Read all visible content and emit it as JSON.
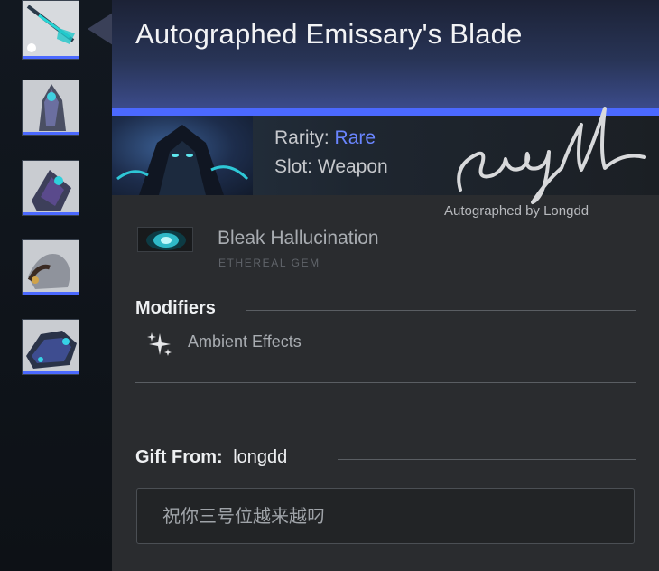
{
  "item": {
    "title": "Autographed Emissary's Blade",
    "rarity_label": "Rarity:",
    "rarity_value": "Rare",
    "slot_label": "Slot:",
    "slot_value": "Weapon",
    "autograph": "Autographed by Longdd",
    "signature_text": "Longdd"
  },
  "gem": {
    "name": "Bleak Hallucination",
    "type": "ETHEREAL GEM",
    "icon": "ethereal-gem-icon"
  },
  "modifiers": {
    "title": "Modifiers",
    "items": [
      {
        "label": "Ambient Effects",
        "icon": "sparkle-icon"
      }
    ]
  },
  "gift": {
    "label": "Gift From:",
    "from": "longdd",
    "message": "祝你三号位越来越叼"
  },
  "sidebar": {
    "items": [
      {
        "name": "emissary-blade",
        "selected": true
      },
      {
        "name": "hero-pose-1"
      },
      {
        "name": "hero-pose-2"
      },
      {
        "name": "hero-pose-3"
      },
      {
        "name": "hero-mount"
      }
    ]
  },
  "colors": {
    "rarity_rare": "#4b69ff",
    "panel_bg": "#2a2c2f",
    "header_top": "#1c2236",
    "header_bottom": "#3b4b8a",
    "text_primary": "#f2f3f5",
    "text_muted": "#a9adb2"
  }
}
